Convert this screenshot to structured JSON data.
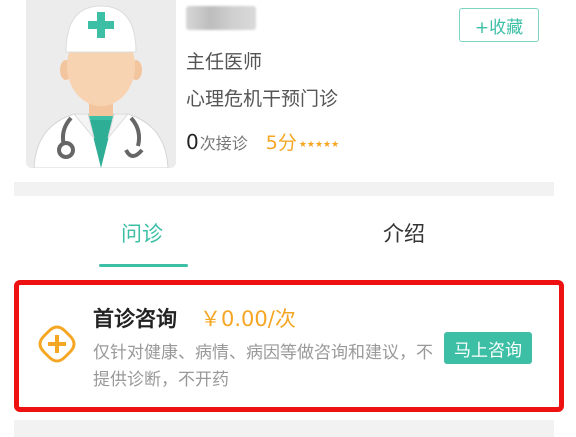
{
  "doctor": {
    "title": "主任医师",
    "department": "心理危机干预门诊",
    "consult_count": "0",
    "consult_label": "次接诊",
    "score": "5分",
    "stars": "★★★★★",
    "favorite_label": "+收藏"
  },
  "tabs": [
    {
      "label": "问诊",
      "active": true
    },
    {
      "label": "介绍",
      "active": false
    }
  ],
  "service": {
    "title": "首诊咨询",
    "price": "￥0.00/次",
    "description": "仅针对健康、病情、病因等做咨询和建议，不提供诊断，不开药",
    "button_label": "马上咨询"
  },
  "colors": {
    "accent": "#3dbfa6",
    "price": "#f5a623",
    "highlight_border": "#ee1111"
  }
}
